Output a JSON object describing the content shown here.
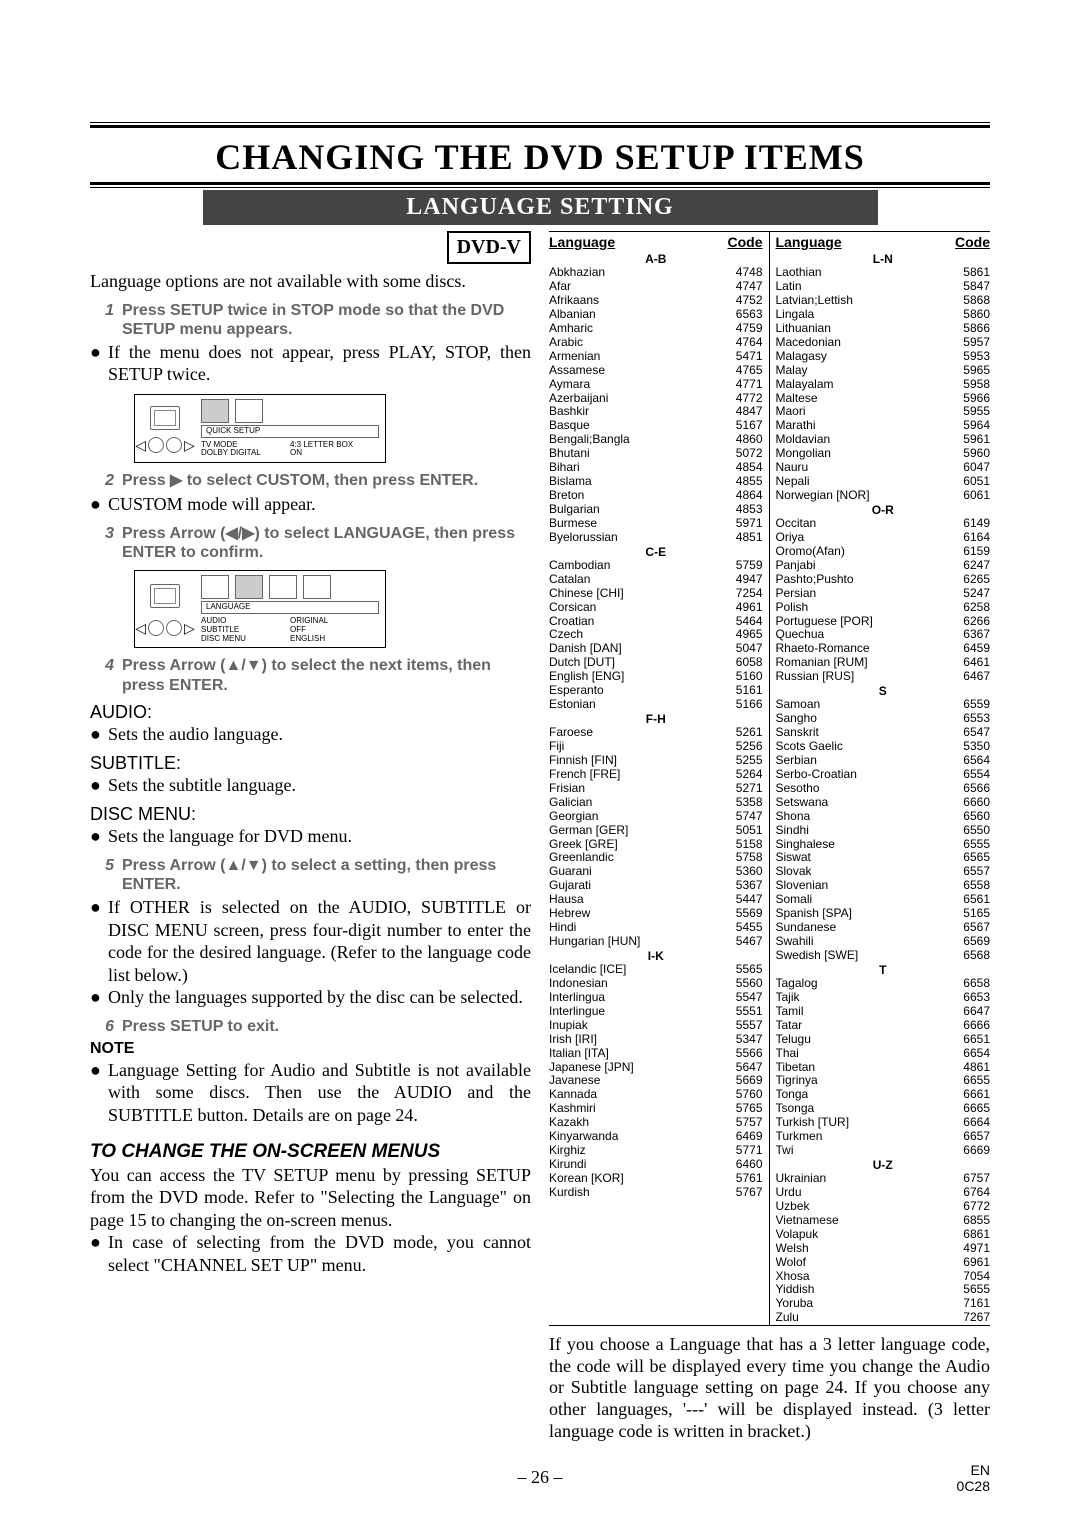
{
  "header": {
    "title": "CHANGING THE DVD SETUP ITEMS",
    "subtitle": "LANGUAGE SETTING"
  },
  "badge": "DVD-V",
  "intro": "Language options are not available with some discs.",
  "steps": {
    "s1": "Press SETUP twice in STOP mode so that the DVD SETUP menu appears.",
    "s1_bullet": "If the menu does not appear, press PLAY, STOP, then SETUP twice.",
    "s2": "Press ▶ to select CUSTOM, then press ENTER.",
    "s2_bullet": "CUSTOM mode will appear.",
    "s3": "Press Arrow (◀/▶) to select LANGUAGE, then press ENTER to confirm.",
    "s4": "Press Arrow (▲/▼) to select the next items, then press ENTER.",
    "s5": "Press Arrow (▲/▼) to select a setting, then press ENTER.",
    "s5_b1": "If OTHER is selected on the AUDIO, SUBTITLE or DISC MENU screen, press four-digit number to enter the code for the desired language. (Refer to the language code list below.)",
    "s5_b2": "Only the languages supported by the disc can be selected.",
    "s6": "Press SETUP to exit."
  },
  "audio": {
    "head": "AUDIO:",
    "text": "Sets the audio language."
  },
  "subtitle": {
    "head": "SUBTITLE:",
    "text": "Sets the subtitle language."
  },
  "discmenu": {
    "head": "DISC MENU:",
    "text": "Sets the language for DVD menu."
  },
  "note": {
    "head": "NOTE",
    "text": "Language Setting for Audio and Subtitle is not available with some discs. Then use the AUDIO and the SUBTITLE button. Details are on page 24."
  },
  "osd_section": {
    "head": "TO CHANGE THE ON-SCREEN MENUS",
    "p1": "You can access the TV SETUP menu by pressing SETUP from the DVD mode. Refer to \"Selecting the Language\" on page 15 to changing the on-screen menus.",
    "b1": "In case of selecting from the DVD mode, you cannot select \"CHANNEL SET UP\" menu."
  },
  "osd1": {
    "bar": "QUICK SETUP",
    "l1": "TV MODE",
    "r1": "4:3 LETTER BOX",
    "l2": "DOLBY DIGITAL",
    "r2": "ON"
  },
  "osd2": {
    "bar": "LANGUAGE",
    "l1": "AUDIO",
    "r1": "ORIGINAL",
    "l2": "SUBTITLE",
    "r2": "OFF",
    "l3": "DISC MENU",
    "r3": "ENGLISH"
  },
  "table_headers": {
    "lang": "Language",
    "code": "Code"
  },
  "groups": {
    "ab": "A-B",
    "ce": "C-E",
    "fh": "F-H",
    "ik": "I-K",
    "ln": "L-N",
    "or": "O-R",
    "s": "S",
    "t": "T",
    "uz": "U-Z"
  },
  "col1": [
    {
      "g": "A-B"
    },
    {
      "n": "Abkhazian",
      "c": "4748"
    },
    {
      "n": "Afar",
      "c": "4747"
    },
    {
      "n": "Afrikaans",
      "c": "4752"
    },
    {
      "n": "Albanian",
      "c": "6563"
    },
    {
      "n": "Amharic",
      "c": "4759"
    },
    {
      "n": "Arabic",
      "c": "4764"
    },
    {
      "n": "Armenian",
      "c": "5471"
    },
    {
      "n": "Assamese",
      "c": "4765"
    },
    {
      "n": "Aymara",
      "c": "4771"
    },
    {
      "n": "Azerbaijani",
      "c": "4772"
    },
    {
      "n": "Bashkir",
      "c": "4847"
    },
    {
      "n": "Basque",
      "c": "5167"
    },
    {
      "n": "Bengali;Bangla",
      "c": "4860"
    },
    {
      "n": "Bhutani",
      "c": "5072"
    },
    {
      "n": "Bihari",
      "c": "4854"
    },
    {
      "n": "Bislama",
      "c": "4855"
    },
    {
      "n": "Breton",
      "c": "4864"
    },
    {
      "n": "Bulgarian",
      "c": "4853"
    },
    {
      "n": "Burmese",
      "c": "5971"
    },
    {
      "n": "Byelorussian",
      "c": "4851"
    },
    {
      "g": "C-E"
    },
    {
      "n": "Cambodian",
      "c": "5759"
    },
    {
      "n": "Catalan",
      "c": "4947"
    },
    {
      "n": "Chinese [CHI]",
      "c": "7254"
    },
    {
      "n": "Corsican",
      "c": "4961"
    },
    {
      "n": "Croatian",
      "c": "5464"
    },
    {
      "n": "Czech",
      "c": "4965"
    },
    {
      "n": "Danish [DAN]",
      "c": "5047"
    },
    {
      "n": "Dutch [DUT]",
      "c": "6058"
    },
    {
      "n": "English [ENG]",
      "c": "5160"
    },
    {
      "n": "Esperanto",
      "c": "5161"
    },
    {
      "n": "Estonian",
      "c": "5166"
    },
    {
      "g": "F-H"
    },
    {
      "n": "Faroese",
      "c": "5261"
    },
    {
      "n": "Fiji",
      "c": "5256"
    },
    {
      "n": "Finnish [FIN]",
      "c": "5255"
    },
    {
      "n": "French [FRE]",
      "c": "5264"
    },
    {
      "n": "Frisian",
      "c": "5271"
    },
    {
      "n": "Galician",
      "c": "5358"
    },
    {
      "n": "Georgian",
      "c": "5747"
    },
    {
      "n": "German [GER]",
      "c": "5051"
    },
    {
      "n": "Greek [GRE]",
      "c": "5158"
    },
    {
      "n": "Greenlandic",
      "c": "5758"
    },
    {
      "n": "Guarani",
      "c": "5360"
    },
    {
      "n": "Gujarati",
      "c": "5367"
    },
    {
      "n": "Hausa",
      "c": "5447"
    },
    {
      "n": "Hebrew",
      "c": "5569"
    },
    {
      "n": "Hindi",
      "c": "5455"
    },
    {
      "n": "Hungarian [HUN]",
      "c": "5467"
    },
    {
      "g": "I-K"
    },
    {
      "n": "Icelandic [ICE]",
      "c": "5565"
    },
    {
      "n": "Indonesian",
      "c": "5560"
    },
    {
      "n": "Interlingua",
      "c": "5547"
    },
    {
      "n": "Interlingue",
      "c": "5551"
    },
    {
      "n": "Inupiak",
      "c": "5557"
    },
    {
      "n": "Irish [IRI]",
      "c": "5347"
    },
    {
      "n": "Italian [ITA]",
      "c": "5566"
    },
    {
      "n": "Japanese [JPN]",
      "c": "5647"
    },
    {
      "n": "Javanese",
      "c": "5669"
    },
    {
      "n": "Kannada",
      "c": "5760"
    },
    {
      "n": "Kashmiri",
      "c": "5765"
    },
    {
      "n": "Kazakh",
      "c": "5757"
    },
    {
      "n": "Kinyarwanda",
      "c": "6469"
    },
    {
      "n": "Kirghiz",
      "c": "5771"
    },
    {
      "n": "Kirundi",
      "c": "6460"
    },
    {
      "n": "Korean [KOR]",
      "c": "5761"
    },
    {
      "n": "Kurdish",
      "c": "5767"
    }
  ],
  "col2": [
    {
      "g": "L-N"
    },
    {
      "n": "Laothian",
      "c": "5861"
    },
    {
      "n": "Latin",
      "c": "5847"
    },
    {
      "n": "Latvian;Lettish",
      "c": "5868"
    },
    {
      "n": "Lingala",
      "c": "5860"
    },
    {
      "n": "Lithuanian",
      "c": "5866"
    },
    {
      "n": "Macedonian",
      "c": "5957"
    },
    {
      "n": "Malagasy",
      "c": "5953"
    },
    {
      "n": "Malay",
      "c": "5965"
    },
    {
      "n": "Malayalam",
      "c": "5958"
    },
    {
      "n": "Maltese",
      "c": "5966"
    },
    {
      "n": "Maori",
      "c": "5955"
    },
    {
      "n": "Marathi",
      "c": "5964"
    },
    {
      "n": "Moldavian",
      "c": "5961"
    },
    {
      "n": "Mongolian",
      "c": "5960"
    },
    {
      "n": "Nauru",
      "c": "6047"
    },
    {
      "n": "Nepali",
      "c": "6051"
    },
    {
      "n": "Norwegian [NOR]",
      "c": "6061"
    },
    {
      "g": "O-R"
    },
    {
      "n": "Occitan",
      "c": "6149"
    },
    {
      "n": "Oriya",
      "c": "6164"
    },
    {
      "n": "Oromo(Afan)",
      "c": "6159"
    },
    {
      "n": "Panjabi",
      "c": "6247"
    },
    {
      "n": "Pashto;Pushto",
      "c": "6265"
    },
    {
      "n": "Persian",
      "c": "5247"
    },
    {
      "n": "Polish",
      "c": "6258"
    },
    {
      "n": "Portuguese [POR]",
      "c": "6266"
    },
    {
      "n": "Quechua",
      "c": "6367"
    },
    {
      "n": "Rhaeto-Romance",
      "c": "6459"
    },
    {
      "n": "Romanian [RUM]",
      "c": "6461"
    },
    {
      "n": "Russian [RUS]",
      "c": "6467"
    },
    {
      "g": "S"
    },
    {
      "n": "Samoan",
      "c": "6559"
    },
    {
      "n": "Sangho",
      "c": "6553"
    },
    {
      "n": "Sanskrit",
      "c": "6547"
    },
    {
      "n": "Scots Gaelic",
      "c": "5350"
    },
    {
      "n": "Serbian",
      "c": "6564"
    },
    {
      "n": "Serbo-Croatian",
      "c": "6554"
    },
    {
      "n": "Sesotho",
      "c": "6566"
    },
    {
      "n": "Setswana",
      "c": "6660"
    },
    {
      "n": "Shona",
      "c": "6560"
    },
    {
      "n": "Sindhi",
      "c": "6550"
    },
    {
      "n": "Singhalese",
      "c": "6555"
    },
    {
      "n": "Siswat",
      "c": "6565"
    },
    {
      "n": "Slovak",
      "c": "6557"
    },
    {
      "n": "Slovenian",
      "c": "6558"
    },
    {
      "n": "Somali",
      "c": "6561"
    },
    {
      "n": "Spanish [SPA]",
      "c": "5165"
    },
    {
      "n": "Sundanese",
      "c": "6567"
    },
    {
      "n": "Swahili",
      "c": "6569"
    },
    {
      "n": "Swedish [SWE]",
      "c": "6568"
    },
    {
      "g": "T"
    },
    {
      "n": "Tagalog",
      "c": "6658"
    },
    {
      "n": "Tajik",
      "c": "6653"
    },
    {
      "n": "Tamil",
      "c": "6647"
    },
    {
      "n": "Tatar",
      "c": "6666"
    },
    {
      "n": "Telugu",
      "c": "6651"
    },
    {
      "n": "Thai",
      "c": "6654"
    },
    {
      "n": "Tibetan",
      "c": "4861"
    },
    {
      "n": "Tigrinya",
      "c": "6655"
    },
    {
      "n": "Tonga",
      "c": "6661"
    },
    {
      "n": "Tsonga",
      "c": "6665"
    },
    {
      "n": "Turkish [TUR]",
      "c": "6664"
    },
    {
      "n": "Turkmen",
      "c": "6657"
    },
    {
      "n": "Twi",
      "c": "6669"
    },
    {
      "g": "U-Z"
    },
    {
      "n": "Ukrainian",
      "c": "6757"
    },
    {
      "n": "Urdu",
      "c": "6764"
    },
    {
      "n": "Uzbek",
      "c": "6772"
    },
    {
      "n": "Vietnamese",
      "c": "6855"
    },
    {
      "n": "Volapuk",
      "c": "6861"
    },
    {
      "n": "Welsh",
      "c": "4971"
    },
    {
      "n": "Wolof",
      "c": "6961"
    },
    {
      "n": "Xhosa",
      "c": "7054"
    },
    {
      "n": "Yiddish",
      "c": "5655"
    },
    {
      "n": "Yoruba",
      "c": "7161"
    },
    {
      "n": "Zulu",
      "c": "7267"
    }
  ],
  "right_note": "If you choose a Language that has a 3 letter language code, the code will be displayed every time you change the Audio or Subtitle language setting on page 24. If you choose any other languages, '---' will be displayed instead. (3 letter language code is written in bracket.)",
  "footer": {
    "page": "– 26 –",
    "r1": "EN",
    "r2": "0C28"
  }
}
